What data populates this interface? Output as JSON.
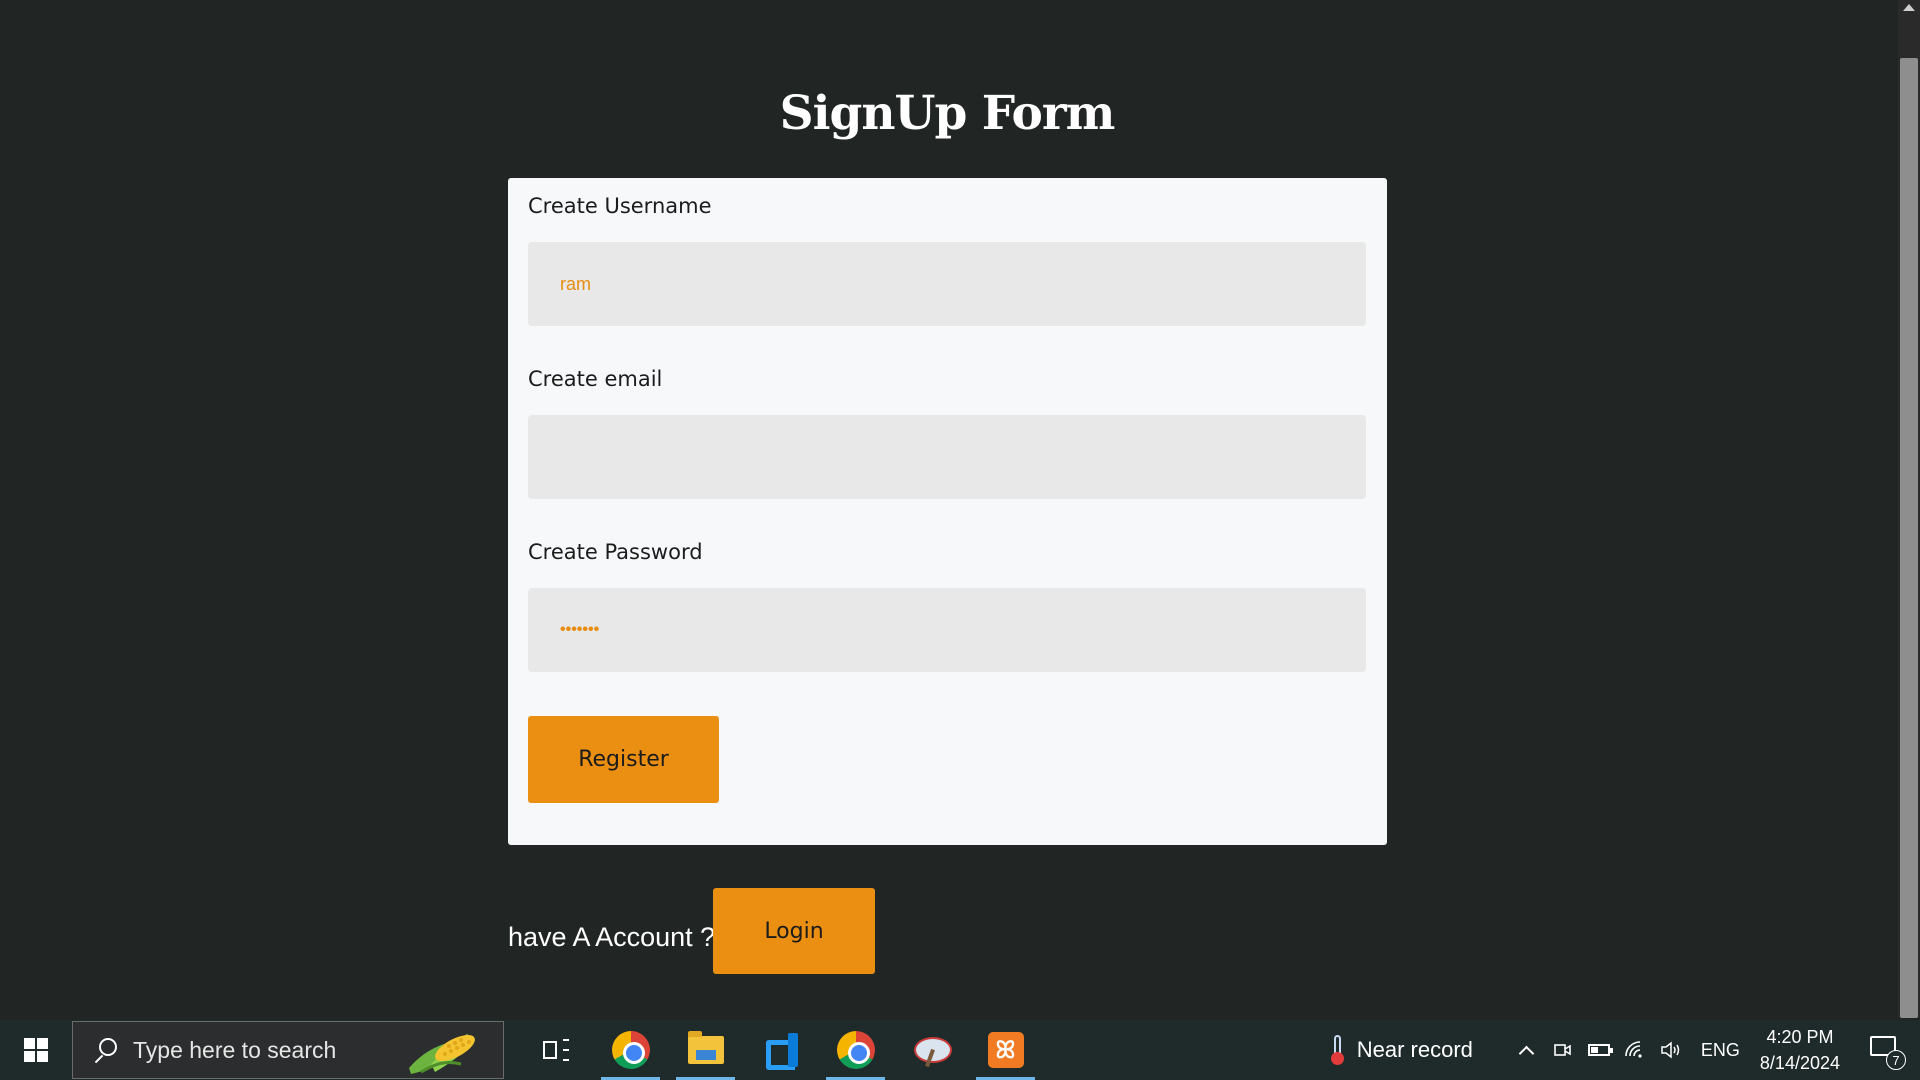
{
  "page": {
    "title": "SignUp Form"
  },
  "form": {
    "username": {
      "label": "Create Username",
      "value": "ram"
    },
    "email": {
      "label": "Create email",
      "value": ""
    },
    "password": {
      "label": "Create Password",
      "value": "•••••••"
    },
    "register_label": "Register"
  },
  "footer": {
    "prompt": "have A Account ?",
    "login_label": "Login"
  },
  "colors": {
    "background": "#212624",
    "card": "#f7f8f9",
    "input": "#e8e8e8",
    "accent": "#ea8f12"
  },
  "taskbar": {
    "search_placeholder": "Type here to search",
    "apps": [
      "task-view-icon",
      "chrome-icon",
      "file-explorer-icon",
      "vscode-icon",
      "chrome-profile-icon",
      "paint-icon",
      "xampp-icon"
    ],
    "weather": "Near record",
    "language": "ENG",
    "time": "4:20 PM",
    "date": "8/14/2024",
    "notification_count": "7",
    "xampp_glyph": "ꕤ"
  }
}
